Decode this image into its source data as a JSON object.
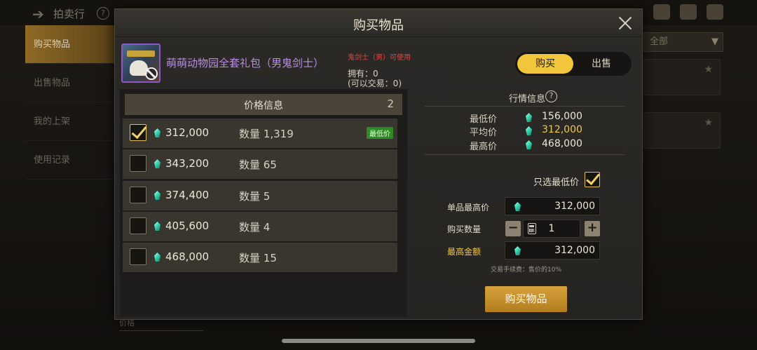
{
  "background": {
    "title": "拍卖行",
    "sidebar": [
      "购买物品",
      "出售物品",
      "我的上架",
      "使用记录"
    ],
    "filter": "全部",
    "sort": "价格"
  },
  "modal": {
    "title": "购买物品",
    "item": {
      "name": "萌萌动物园全套礼包（男鬼剑士）",
      "class_note": "鬼剑士（男）可使用",
      "owned": "拥有：0",
      "tradable": "(可以交易：0)"
    },
    "toggle": {
      "buy": "购买",
      "sell": "出售",
      "selected": "购买"
    },
    "price_list": {
      "title": "价格信息",
      "count": "2",
      "qty_prefix": "数量",
      "rows": [
        {
          "price": "312,000",
          "qty": "1,319",
          "badge": "最低价",
          "checked": true
        },
        {
          "price": "343,200",
          "qty": "65",
          "badge": "",
          "checked": false
        },
        {
          "price": "374,400",
          "qty": "5",
          "badge": "",
          "checked": false
        },
        {
          "price": "405,600",
          "qty": "4",
          "badge": "",
          "checked": false
        },
        {
          "price": "468,000",
          "qty": "15",
          "badge": "",
          "checked": false
        }
      ]
    },
    "market": {
      "title": "行情信息",
      "help": "?",
      "lowest_label": "最低价",
      "lowest": "156,000",
      "average_label": "平均价",
      "average": "312,000",
      "highest_label": "最高价",
      "highest": "468,000"
    },
    "form": {
      "lowest_only_label": "只选最低价",
      "max_unit_label": "单品最高价",
      "max_unit": "312,000",
      "qty_label": "购买数量",
      "qty": "1",
      "total_label": "最高金额",
      "total": "312,000",
      "fee_note": "交易手续费：售价的10%"
    },
    "buy_button": "购买物品"
  },
  "colors": {
    "accent": "#f1c63a",
    "item_name": "#b98ce6",
    "warning": "#e8423e",
    "badge": "#2e8a23"
  },
  "icons": [
    "back-arrow-icon",
    "close-icon",
    "gem-icon",
    "ban-icon",
    "help-icon",
    "calculator-icon",
    "checkmark-icon"
  ]
}
